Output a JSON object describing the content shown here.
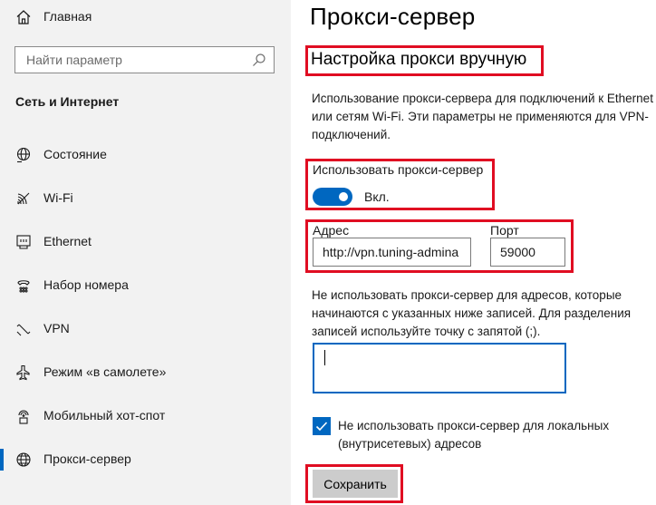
{
  "sidebar": {
    "home_label": "Главная",
    "search_placeholder": "Найти параметр",
    "section_title": "Сеть и Интернет",
    "items": [
      {
        "label": "Состояние",
        "icon": "globe-status-icon"
      },
      {
        "label": "Wi-Fi",
        "icon": "wifi-icon"
      },
      {
        "label": "Ethernet",
        "icon": "ethernet-icon"
      },
      {
        "label": "Набор номера",
        "icon": "dialup-icon"
      },
      {
        "label": "VPN",
        "icon": "vpn-icon"
      },
      {
        "label": "Режим «в самолете»",
        "icon": "airplane-icon"
      },
      {
        "label": "Мобильный хот-спот",
        "icon": "hotspot-icon"
      },
      {
        "label": "Прокси-сервер",
        "icon": "globe-icon",
        "active": true
      }
    ]
  },
  "main": {
    "title": "Прокси-сервер",
    "subtitle": "Настройка прокси вручную",
    "description": "Использование прокси-сервера для подключений к Ethernet или сетям Wi-Fi. Эти параметры не применяются для VPN-подключений.",
    "use_proxy_label": "Использовать прокси-сервер",
    "toggle_state": "Вкл.",
    "address_label": "Адрес",
    "address_value": "http://vpn.tuning-admina",
    "port_label": "Порт",
    "port_value": "59000",
    "exclusions_description": "Не использовать прокси-сервер для адресов, которые начинаются с указанных ниже записей. Для разделения записей используйте точку с запятой (;).",
    "exclusions_value": "",
    "local_bypass_label": "Не использовать прокси-сервер для локальных (внутрисетевых) адресов",
    "local_bypass_checked": true,
    "save_label": "Сохранить"
  },
  "colors": {
    "accent": "#0067c0",
    "highlight_box": "#e00d22",
    "sidebar_bg": "#f2f2f2"
  }
}
